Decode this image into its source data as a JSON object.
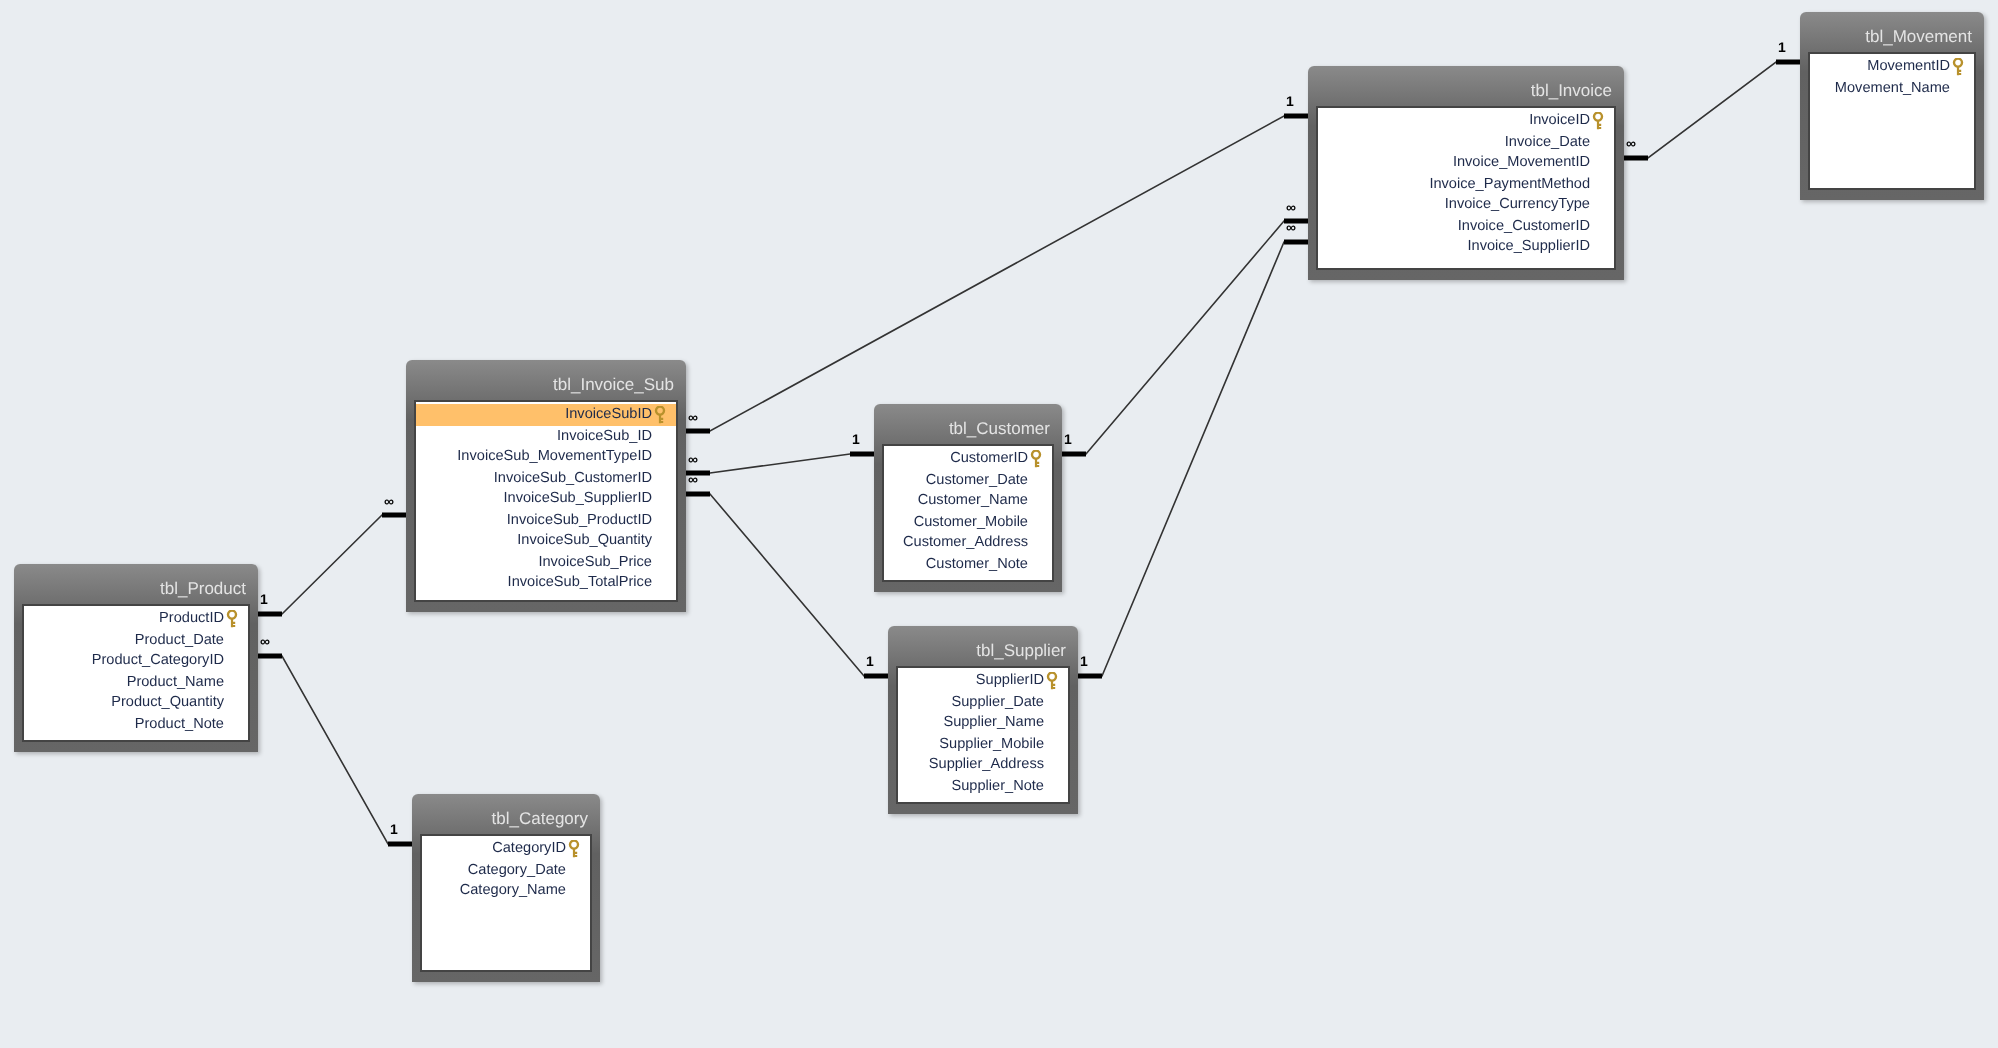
{
  "tables": [
    {
      "name": "tbl_Product",
      "fields": [
        {
          "name": "ProductID",
          "primary_key": true,
          "selected": false
        },
        {
          "name": "Product_Date",
          "primary_key": false,
          "selected": false
        },
        {
          "name": "Product_CategoryID",
          "primary_key": false,
          "selected": false
        },
        {
          "name": "Product_Name",
          "primary_key": false,
          "selected": false
        },
        {
          "name": "Product_Quantity",
          "primary_key": false,
          "selected": false
        },
        {
          "name": "Product_Note",
          "primary_key": false,
          "selected": false
        }
      ]
    },
    {
      "name": "tbl_Invoice_Sub",
      "fields": [
        {
          "name": "InvoiceSubID",
          "primary_key": true,
          "selected": true
        },
        {
          "name": "InvoiceSub_ID",
          "primary_key": false,
          "selected": false
        },
        {
          "name": "InvoiceSub_MovementTypeID",
          "primary_key": false,
          "selected": false
        },
        {
          "name": "InvoiceSub_CustomerID",
          "primary_key": false,
          "selected": false
        },
        {
          "name": "InvoiceSub_SupplierID",
          "primary_key": false,
          "selected": false
        },
        {
          "name": "InvoiceSub_ProductID",
          "primary_key": false,
          "selected": false
        },
        {
          "name": "InvoiceSub_Quantity",
          "primary_key": false,
          "selected": false
        },
        {
          "name": "InvoiceSub_Price",
          "primary_key": false,
          "selected": false
        },
        {
          "name": "InvoiceSub_TotalPrice",
          "primary_key": false,
          "selected": false
        }
      ]
    },
    {
      "name": "tbl_Category",
      "fields": [
        {
          "name": "CategoryID",
          "primary_key": true,
          "selected": false
        },
        {
          "name": "Category_Date",
          "primary_key": false,
          "selected": false
        },
        {
          "name": "Category_Name",
          "primary_key": false,
          "selected": false
        }
      ]
    },
    {
      "name": "tbl_Customer",
      "fields": [
        {
          "name": "CustomerID",
          "primary_key": true,
          "selected": false
        },
        {
          "name": "Customer_Date",
          "primary_key": false,
          "selected": false
        },
        {
          "name": "Customer_Name",
          "primary_key": false,
          "selected": false
        },
        {
          "name": "Customer_Mobile",
          "primary_key": false,
          "selected": false
        },
        {
          "name": "Customer_Address",
          "primary_key": false,
          "selected": false
        },
        {
          "name": "Customer_Note",
          "primary_key": false,
          "selected": false
        }
      ]
    },
    {
      "name": "tbl_Supplier",
      "fields": [
        {
          "name": "SupplierID",
          "primary_key": true,
          "selected": false
        },
        {
          "name": "Supplier_Date",
          "primary_key": false,
          "selected": false
        },
        {
          "name": "Supplier_Name",
          "primary_key": false,
          "selected": false
        },
        {
          "name": "Supplier_Mobile",
          "primary_key": false,
          "selected": false
        },
        {
          "name": "Supplier_Address",
          "primary_key": false,
          "selected": false
        },
        {
          "name": "Supplier_Note",
          "primary_key": false,
          "selected": false
        }
      ]
    },
    {
      "name": "tbl_Invoice",
      "fields": [
        {
          "name": "InvoiceID",
          "primary_key": true,
          "selected": false
        },
        {
          "name": "Invoice_Date",
          "primary_key": false,
          "selected": false
        },
        {
          "name": "Invoice_MovementID",
          "primary_key": false,
          "selected": false
        },
        {
          "name": "Invoice_PaymentMethod",
          "primary_key": false,
          "selected": false
        },
        {
          "name": "Invoice_CurrencyType",
          "primary_key": false,
          "selected": false
        },
        {
          "name": "Invoice_CustomerID",
          "primary_key": false,
          "selected": false
        },
        {
          "name": "Invoice_SupplierID",
          "primary_key": false,
          "selected": false
        }
      ]
    },
    {
      "name": "tbl_Movement",
      "fields": [
        {
          "name": "MovementID",
          "primary_key": true,
          "selected": false
        },
        {
          "name": "Movement_Name",
          "primary_key": false,
          "selected": false
        }
      ]
    }
  ],
  "relationships": [
    {
      "from_label": "1",
      "to_label": "∞"
    },
    {
      "from_label": "∞",
      "to_label": "1"
    },
    {
      "from_label": "∞",
      "to_label": "1"
    },
    {
      "from_label": "∞",
      "to_label": "1"
    },
    {
      "from_label": "∞",
      "to_label": "1"
    },
    {
      "from_label": "1",
      "to_label": "∞"
    },
    {
      "from_label": "1",
      "to_label": "∞"
    },
    {
      "from_label": "∞",
      "to_label": "1"
    }
  ]
}
